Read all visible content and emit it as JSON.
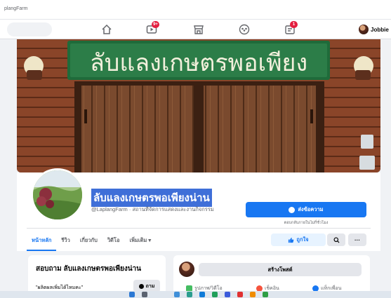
{
  "browser": {
    "url": "plangFarm"
  },
  "nav": {
    "video_badge": "9+",
    "notif_badge": "1",
    "user_name": "Jobbie"
  },
  "cover": {
    "sign_text": "ลับแลงเกษตรพอเพียง"
  },
  "profile": {
    "name": "ลับแลงเกษตรพอเพียงน่าน",
    "subtitle": "@LaplangFarm · สถานที่จัดการแสดงและงานกิจกรรม",
    "send_message_label": "ส่งข้อความ",
    "response_note": "ตอบกลับภายในไม่กี่ชั่วโมง"
  },
  "tabs": [
    {
      "label": "หน้าหลัก",
      "active": true
    },
    {
      "label": "รีวิว",
      "active": false
    },
    {
      "label": "เกี่ยวกับ",
      "active": false
    },
    {
      "label": "วิดีโอ",
      "active": false
    },
    {
      "label": "เพิ่มเติม ▾",
      "active": false
    }
  ],
  "actions": {
    "like_label": "ถูกใจ",
    "search_symbol": "🔍",
    "more_symbol": "···"
  },
  "ask_card": {
    "title": "สอบถาม ลับแลงเกษตรพอเพียงน่าน",
    "question": "\"ผลิตผลเพิ่มได้ไหมคะ\"",
    "ask_label": "ถาม"
  },
  "post_card": {
    "create_post_label": "สร้างโพสต์",
    "photo_video_label": "รูปภาพ/วิดีโอ",
    "checkin_label": "เช็คอิน",
    "tag_friends_label": "แท็กเพื่อน"
  },
  "colors": {
    "accent": "#1877f2",
    "badge": "#e41e3f",
    "name_highlight": "#3f6fd8"
  }
}
